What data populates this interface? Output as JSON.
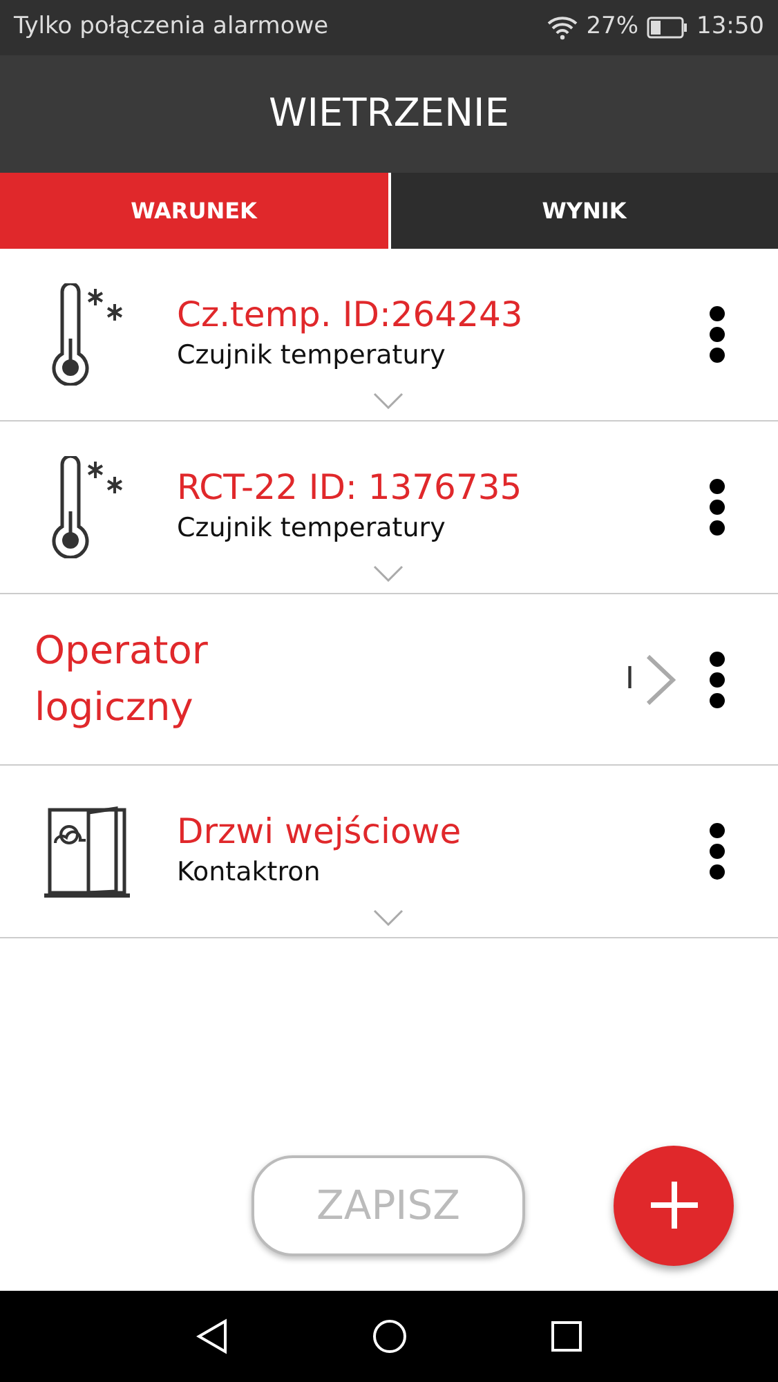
{
  "status_bar": {
    "carrier": "Tylko połączenia alarmowe",
    "battery_percent": "27%",
    "time": "13:50"
  },
  "header": {
    "title": "WIETRZENIE"
  },
  "tabs": [
    {
      "label": "WARUNEK",
      "selected": true
    },
    {
      "label": "WYNIK",
      "selected": false
    }
  ],
  "rows": [
    {
      "kind": "thermometer",
      "title": "Cz.temp. ID:264243",
      "subtitle": "Czujnik temperatury"
    },
    {
      "kind": "thermometer",
      "title": "RCT-22 ID: 1376735",
      "subtitle": "Czujnik temperatury"
    },
    {
      "kind": "operator",
      "title": "Operator logiczny",
      "value": "I"
    },
    {
      "kind": "door",
      "title": "Drzwi wejściowe",
      "subtitle": "Kontaktron"
    }
  ],
  "save_button": {
    "label": "ZAPISZ",
    "disabled": true
  }
}
